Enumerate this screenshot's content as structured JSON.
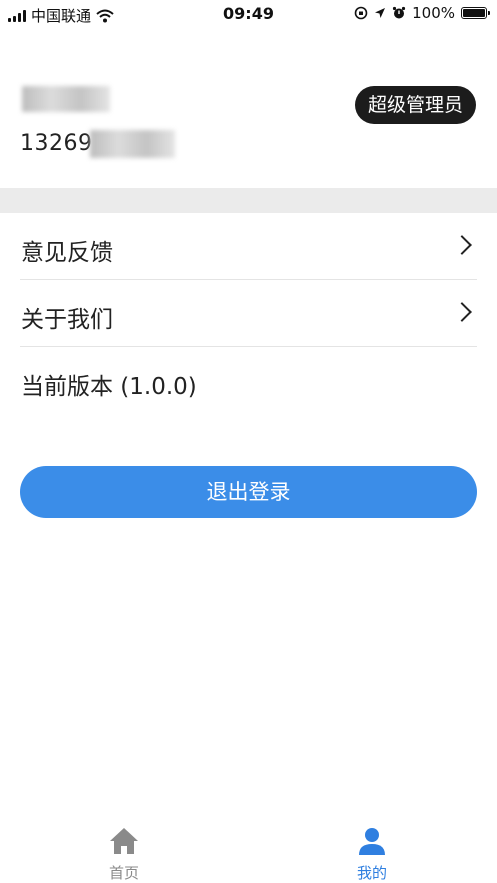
{
  "status_bar": {
    "carrier": "中国联通",
    "time": "09:49",
    "battery": "100%",
    "battery_level": 1.0,
    "icons": [
      "signal-icon",
      "wifi-icon",
      "orientation-lock-icon",
      "location-icon",
      "alarm-icon",
      "battery-icon"
    ]
  },
  "profile": {
    "name_visible": "",
    "phone_visible": "13269",
    "role_badge": "超级管理员"
  },
  "menu": {
    "items": [
      {
        "label": "意见反馈",
        "icon": "chevron-right-icon"
      },
      {
        "label": "关于我们",
        "icon": "chevron-right-icon"
      },
      {
        "label": "当前版本 (1.0.0)"
      }
    ]
  },
  "logout_button": {
    "label": "退出登录",
    "color": "#3b8de8"
  },
  "tab_bar": {
    "tabs": [
      {
        "label": "首页",
        "icon": "home-icon",
        "active": false,
        "color": "#8a8a8a"
      },
      {
        "label": "我的",
        "icon": "user-icon",
        "active": true,
        "color": "#2f7fe0"
      }
    ]
  }
}
